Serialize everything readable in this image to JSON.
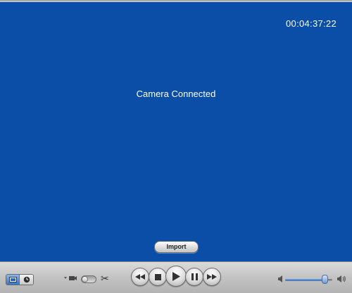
{
  "viewer": {
    "timecode": "00:04:37:22",
    "status": "Camera Connected",
    "background_color": "#0b4ea7"
  },
  "import_button": {
    "label": "Import"
  },
  "controls": {
    "mode_buttons": [
      {
        "icon": "clip-view-icon",
        "active": true
      },
      {
        "icon": "clock-icon",
        "active": false
      }
    ],
    "camera_switch_icon": "camera-icon",
    "toggle_state": "off",
    "edit_icon": "scissors-icon",
    "edit_glyph": "✂",
    "transport": [
      {
        "icon": "rewind-icon"
      },
      {
        "icon": "stop-icon"
      },
      {
        "icon": "play-icon"
      },
      {
        "icon": "pause-icon"
      },
      {
        "icon": "fast-forward-icon"
      }
    ],
    "volume": {
      "level": 0.85,
      "low_icon": "speaker-low-icon",
      "high_icon": "speaker-high-icon"
    }
  }
}
